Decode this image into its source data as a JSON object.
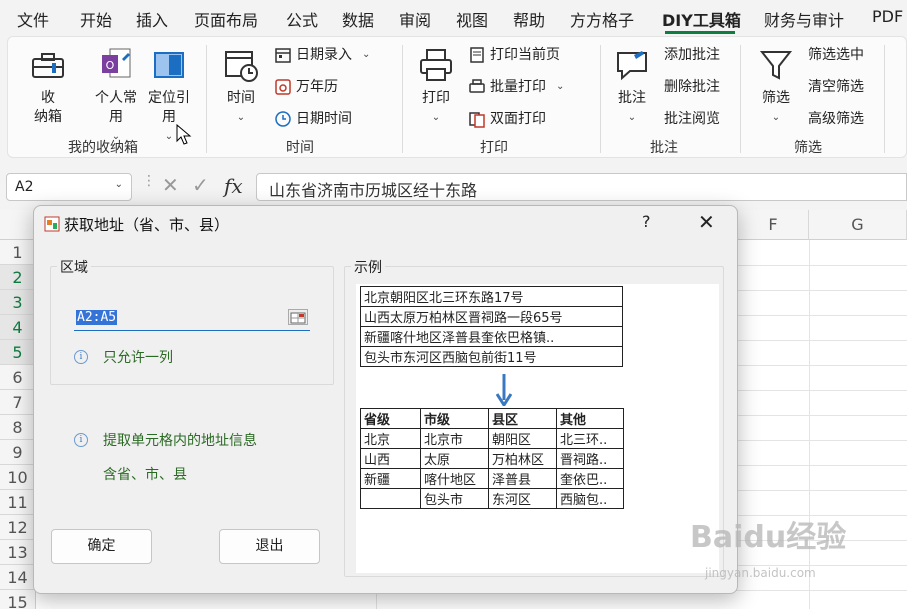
{
  "menu": {
    "tabs": [
      "文件",
      "开始",
      "插入",
      "页面布局",
      "公式",
      "数据",
      "审阅",
      "视图",
      "帮助",
      "方方格子",
      "DIY工具箱",
      "财务与审计",
      "PDF"
    ],
    "active": "DIY工具箱"
  },
  "ribbon": {
    "groups": {
      "storage": {
        "label": "我的收纳箱",
        "btn_box": "收\n纳箱",
        "btn_personal": "个人常\n用",
        "btn_locate": "定位引\n用"
      },
      "time": {
        "label": "时间",
        "btn_time": "时间",
        "date_entry": "日期录入",
        "calendar": "万年历",
        "datetime": "日期时间"
      },
      "print": {
        "label": "打印",
        "btn_print": "打印",
        "print_page": "打印当前页",
        "batch_print": "批量打印",
        "duplex_print": "双面打印"
      },
      "comment": {
        "label": "批注",
        "btn_comment": "批注",
        "add": "添加批注",
        "delete": "删除批注",
        "read": "批注阅览"
      },
      "filter": {
        "label": "筛选",
        "btn_filter": "筛选",
        "filter_selected": "筛选选中",
        "clear_filter": "清空筛选",
        "advanced": "高级筛选"
      }
    }
  },
  "formula_bar": {
    "name_box": "A2",
    "fx": "fx",
    "formula": "山东省济南市历城区经十东路"
  },
  "grid": {
    "columns": [
      "F",
      "G"
    ],
    "rows": [
      "1",
      "2",
      "3",
      "4",
      "5",
      "6",
      "7",
      "8",
      "9",
      "10",
      "11",
      "12",
      "13",
      "14",
      "15"
    ]
  },
  "dialog": {
    "title": "获取地址（省、市、县）",
    "help": "?",
    "close": "✕",
    "region_legend": "区域",
    "range_value": "A2:A5",
    "hint_single_column": "只允许一列",
    "hint_extract": "提取单元格内的地址信息",
    "hint_extract_2": "含省、市、县",
    "ok_label": "确定",
    "exit_label": "退出",
    "example_legend": "示例",
    "example_source": [
      "北京朝阳区北三环东路17号",
      "山西太原万柏林区晋祠路一段65号",
      "新疆喀什地区泽普县奎依巴格镇..",
      "包头市东河区西脑包前街11号"
    ],
    "example_headers": [
      "省级",
      "市级",
      "县区",
      "其他"
    ],
    "example_rows": [
      [
        "北京",
        "北京市",
        "朝阳区",
        "北三环.."
      ],
      [
        "山西",
        "太原",
        "万柏林区",
        "晋祠路.."
      ],
      [
        "新疆",
        "喀什地区",
        "泽普县",
        "奎依巴.."
      ],
      [
        "",
        "包头市",
        "东河区",
        "西脑包.."
      ]
    ]
  },
  "watermark": {
    "logo": "Baidu经验",
    "url": "jingyan.baidu.com"
  },
  "colors": {
    "accent": "#107c41",
    "selection": "#3574d6",
    "hint_text": "#2b6a24"
  }
}
